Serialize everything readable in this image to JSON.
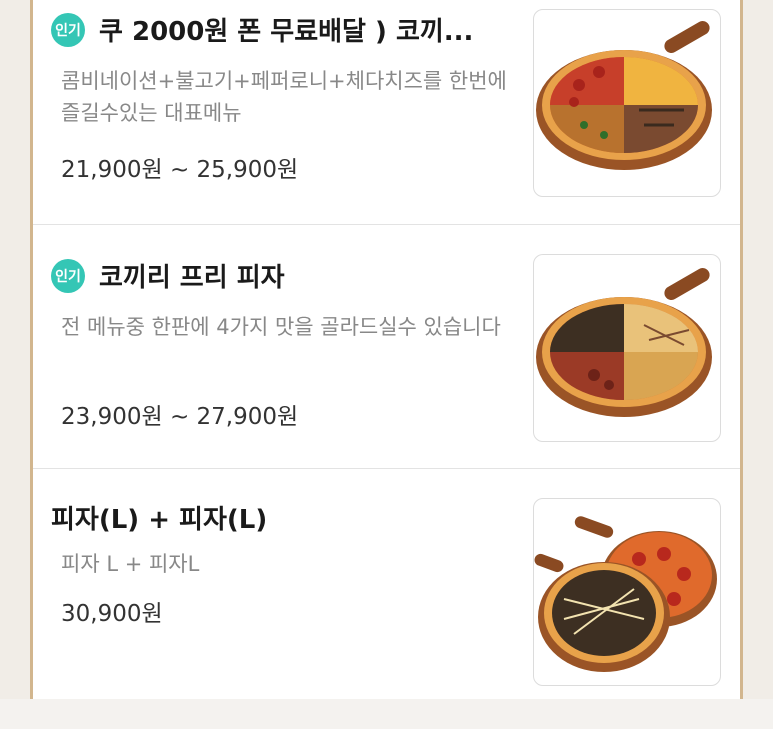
{
  "menu": {
    "items": [
      {
        "badge": "인기",
        "title": "쿠 2000원 폰 무료배달 ) 코끼...",
        "desc": "콤비네이션+불고기+페퍼로니+체다치즈를 한번에 즐길수있는 대표메뉴",
        "price": "21,900원 ~ 25,900원",
        "image_icon": "combo-pizza-image"
      },
      {
        "badge": "인기",
        "title": "코끼리 프리 피자",
        "desc": "전 메뉴중 한판에 4가지 맛을 골라드실수 있습니다",
        "price": "23,900원 ~ 27,900원",
        "image_icon": "quarter-pizza-image"
      },
      {
        "title": "피자(L) + 피자(L)",
        "desc": "피자 L + 피자L",
        "price": "30,900원",
        "image_icon": "two-pizzas-image"
      }
    ]
  },
  "colors": {
    "badge": "#34c6b5",
    "frame": "#d2b68e"
  }
}
